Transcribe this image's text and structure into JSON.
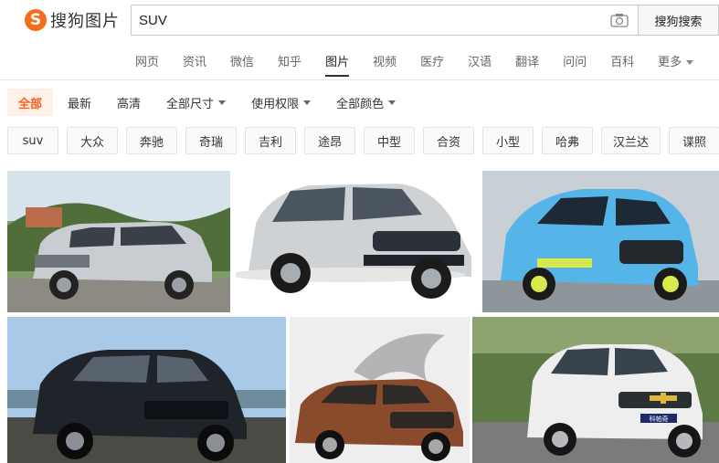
{
  "logo": {
    "mark": "S",
    "text": "搜狗图片"
  },
  "search": {
    "query": "SUV",
    "button": "搜狗搜索"
  },
  "nav": [
    "网页",
    "资讯",
    "微信",
    "知乎",
    "图片",
    "视频",
    "医疗",
    "汉语",
    "翻译",
    "问问",
    "百科",
    "更多"
  ],
  "nav_active": "图片",
  "filters": [
    "全部",
    "最新",
    "高清",
    "全部尺寸",
    "使用权限",
    "全部颜色"
  ],
  "tags": [
    "suv",
    "大众",
    "奔驰",
    "奇瑞",
    "吉利",
    "途昂",
    "中型",
    "合资",
    "小型",
    "哈弗",
    "汉兰达",
    "谍照"
  ],
  "images": [
    {
      "name": "silver-suv-outdoor",
      "body_color": "#c9ccd0",
      "bg": "#6e8c5a"
    },
    {
      "name": "silver-honda-crv",
      "body_color": "#d2d4d6",
      "bg": "#ffffff"
    },
    {
      "name": "blue-luxgen-suv",
      "body_color": "#56b5e8",
      "bg": "#c9d1d6"
    },
    {
      "name": "black-suv-beach",
      "body_color": "#1f232a",
      "bg": "#9fc3e6"
    },
    {
      "name": "bronze-luxgen-suv",
      "body_color": "#8a4a2c",
      "bg": "#ececec"
    },
    {
      "name": "white-chevrolet-captiva",
      "body_color": "#eeeeee",
      "bg": "#5d7a44"
    }
  ],
  "image_labels": {
    "chevrolet_plate": "科帕奇"
  },
  "colors": {
    "accent": "#ff5f19",
    "brand": "#f76b1c"
  }
}
